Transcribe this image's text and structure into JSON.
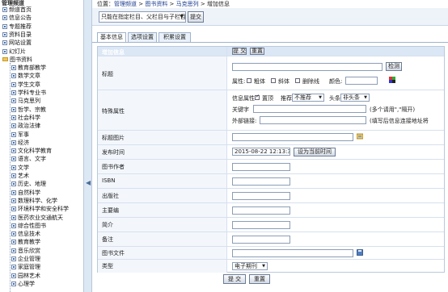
{
  "tree": {
    "header": "管理频道",
    "items": [
      {
        "label": "频道首页",
        "type": "page",
        "level": 1
      },
      {
        "label": "信息公告",
        "type": "page",
        "level": 1
      },
      {
        "label": "专题推荐",
        "type": "page",
        "level": 1
      },
      {
        "label": "资料目录",
        "type": "page",
        "level": 1
      },
      {
        "label": "网站设置",
        "type": "page",
        "level": 1
      },
      {
        "label": "幻灯片",
        "type": "page",
        "level": 1
      },
      {
        "label": "图书资料",
        "type": "folder",
        "level": 1
      },
      {
        "label": "教育部教学",
        "type": "page",
        "level": 2
      },
      {
        "label": "数学文章",
        "type": "page",
        "level": 2
      },
      {
        "label": "学生文章",
        "type": "page",
        "level": 2
      },
      {
        "label": "学科专业书",
        "type": "page",
        "level": 2
      },
      {
        "label": "马克思列",
        "type": "page",
        "level": 2
      },
      {
        "label": "哲学、宗教",
        "type": "page",
        "level": 2
      },
      {
        "label": "社会科学",
        "type": "page",
        "level": 2
      },
      {
        "label": "政治法律",
        "type": "page",
        "level": 2
      },
      {
        "label": "军事",
        "type": "page",
        "level": 2
      },
      {
        "label": "经济",
        "type": "page",
        "level": 2
      },
      {
        "label": "文化科学教育",
        "type": "page",
        "level": 2
      },
      {
        "label": "语言、文字",
        "type": "page",
        "level": 2
      },
      {
        "label": "文学",
        "type": "page",
        "level": 2
      },
      {
        "label": "艺术",
        "type": "page",
        "level": 2
      },
      {
        "label": "历史、地理",
        "type": "page",
        "level": 2
      },
      {
        "label": "自然科学",
        "type": "page",
        "level": 2
      },
      {
        "label": "数理科学、化学",
        "type": "page",
        "level": 2
      },
      {
        "label": "环境科学和安全科学",
        "type": "page",
        "level": 2
      },
      {
        "label": "医药农业交通航天",
        "type": "page",
        "level": 2
      },
      {
        "label": "综合性图书",
        "type": "page",
        "level": 2
      },
      {
        "label": "信息技术",
        "type": "page",
        "level": 2
      },
      {
        "label": "教育教学",
        "type": "page",
        "level": 2
      },
      {
        "label": "音乐欣赏",
        "type": "page",
        "level": 2
      },
      {
        "label": "企业管理",
        "type": "page",
        "level": 2
      },
      {
        "label": "家庭管理",
        "type": "page",
        "level": 2
      },
      {
        "label": "园林艺术",
        "type": "page",
        "level": 2
      },
      {
        "label": "心理学",
        "type": "page",
        "level": 2
      }
    ]
  },
  "location": {
    "prefix": "位置：",
    "crumbs": [
      "管理频道",
      "图书资料",
      "马克思列",
      "增加信息"
    ],
    "sep": " > "
  },
  "top": {
    "category_select": "只能在指定栏目、父栏目与子栏目",
    "submit": "提交"
  },
  "tabs": [
    "基本信息",
    "选项设置",
    "积累设置"
  ],
  "form": {
    "header_label": "增加信息",
    "header_submit": "提 交",
    "header_reset": "重置",
    "title_label": "标题",
    "check_button": "检测",
    "attr_label": "属性:",
    "attr_options": [
      "粗体",
      "斜体",
      "删除线"
    ],
    "color_label": "颜色:",
    "special_label": "特殊属性",
    "info_attr_label": "信息属性:",
    "info_attr_options": [
      "置顶",
      "推荐"
    ],
    "recommend_select": "不推荐",
    "head_label": "头条",
    "head_select": "非头条",
    "keyword_label": "关键字",
    "keyword_hint": "(多个请用\",\"隔开)",
    "external_label": "外部链接:",
    "external_hint": "(填写后信息连接地址将",
    "image_label": "标题图片",
    "pubtime_label": "发布时间",
    "pubtime_value": "2015-08-22 12:13:31",
    "pubtime_button": "设为当前时间",
    "author_label": "图书作者",
    "isbn_label": "ISBN",
    "publisher_label": "出版社",
    "editor_label": "主要编",
    "intro_label": "简介",
    "note_label": "备注",
    "file_label": "图书文件",
    "type_label": "类型",
    "type_select": "电子期刊"
  },
  "bottom": {
    "submit": "提 交",
    "reset": "重置"
  },
  "colors": {
    "header_bg": "#dbe7f5",
    "label_bg": "#f3f7fc",
    "border": "#b9c9de",
    "link": "#1a3c8f"
  }
}
